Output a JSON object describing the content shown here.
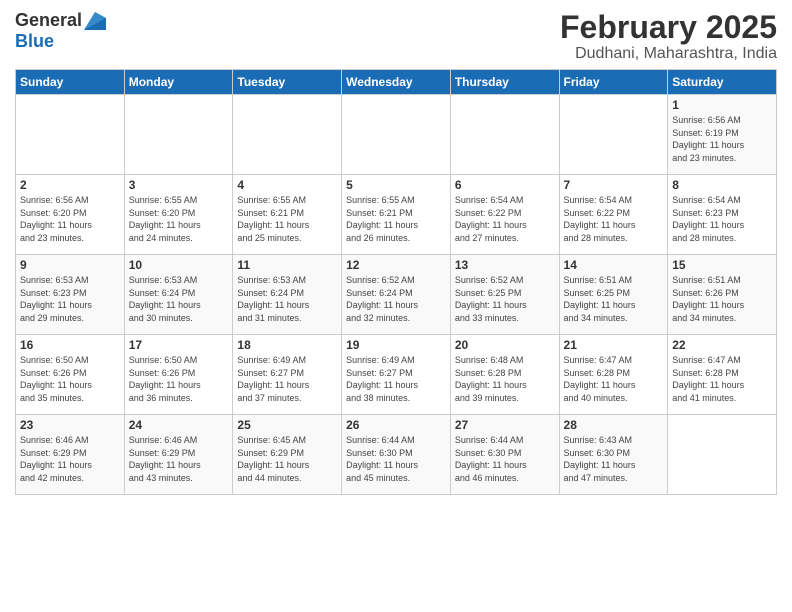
{
  "logo": {
    "general": "General",
    "blue": "Blue"
  },
  "title": "February 2025",
  "subtitle": "Dudhani, Maharashtra, India",
  "header": {
    "days": [
      "Sunday",
      "Monday",
      "Tuesday",
      "Wednesday",
      "Thursday",
      "Friday",
      "Saturday"
    ]
  },
  "weeks": [
    {
      "cells": [
        {
          "day": "",
          "info": ""
        },
        {
          "day": "",
          "info": ""
        },
        {
          "day": "",
          "info": ""
        },
        {
          "day": "",
          "info": ""
        },
        {
          "day": "",
          "info": ""
        },
        {
          "day": "",
          "info": ""
        },
        {
          "day": "1",
          "info": "Sunrise: 6:56 AM\nSunset: 6:19 PM\nDaylight: 11 hours\nand 23 minutes."
        }
      ]
    },
    {
      "cells": [
        {
          "day": "2",
          "info": "Sunrise: 6:56 AM\nSunset: 6:20 PM\nDaylight: 11 hours\nand 23 minutes."
        },
        {
          "day": "3",
          "info": "Sunrise: 6:55 AM\nSunset: 6:20 PM\nDaylight: 11 hours\nand 24 minutes."
        },
        {
          "day": "4",
          "info": "Sunrise: 6:55 AM\nSunset: 6:21 PM\nDaylight: 11 hours\nand 25 minutes."
        },
        {
          "day": "5",
          "info": "Sunrise: 6:55 AM\nSunset: 6:21 PM\nDaylight: 11 hours\nand 26 minutes."
        },
        {
          "day": "6",
          "info": "Sunrise: 6:54 AM\nSunset: 6:22 PM\nDaylight: 11 hours\nand 27 minutes."
        },
        {
          "day": "7",
          "info": "Sunrise: 6:54 AM\nSunset: 6:22 PM\nDaylight: 11 hours\nand 28 minutes."
        },
        {
          "day": "8",
          "info": "Sunrise: 6:54 AM\nSunset: 6:23 PM\nDaylight: 11 hours\nand 28 minutes."
        }
      ]
    },
    {
      "cells": [
        {
          "day": "9",
          "info": "Sunrise: 6:53 AM\nSunset: 6:23 PM\nDaylight: 11 hours\nand 29 minutes."
        },
        {
          "day": "10",
          "info": "Sunrise: 6:53 AM\nSunset: 6:24 PM\nDaylight: 11 hours\nand 30 minutes."
        },
        {
          "day": "11",
          "info": "Sunrise: 6:53 AM\nSunset: 6:24 PM\nDaylight: 11 hours\nand 31 minutes."
        },
        {
          "day": "12",
          "info": "Sunrise: 6:52 AM\nSunset: 6:24 PM\nDaylight: 11 hours\nand 32 minutes."
        },
        {
          "day": "13",
          "info": "Sunrise: 6:52 AM\nSunset: 6:25 PM\nDaylight: 11 hours\nand 33 minutes."
        },
        {
          "day": "14",
          "info": "Sunrise: 6:51 AM\nSunset: 6:25 PM\nDaylight: 11 hours\nand 34 minutes."
        },
        {
          "day": "15",
          "info": "Sunrise: 6:51 AM\nSunset: 6:26 PM\nDaylight: 11 hours\nand 34 minutes."
        }
      ]
    },
    {
      "cells": [
        {
          "day": "16",
          "info": "Sunrise: 6:50 AM\nSunset: 6:26 PM\nDaylight: 11 hours\nand 35 minutes."
        },
        {
          "day": "17",
          "info": "Sunrise: 6:50 AM\nSunset: 6:26 PM\nDaylight: 11 hours\nand 36 minutes."
        },
        {
          "day": "18",
          "info": "Sunrise: 6:49 AM\nSunset: 6:27 PM\nDaylight: 11 hours\nand 37 minutes."
        },
        {
          "day": "19",
          "info": "Sunrise: 6:49 AM\nSunset: 6:27 PM\nDaylight: 11 hours\nand 38 minutes."
        },
        {
          "day": "20",
          "info": "Sunrise: 6:48 AM\nSunset: 6:28 PM\nDaylight: 11 hours\nand 39 minutes."
        },
        {
          "day": "21",
          "info": "Sunrise: 6:47 AM\nSunset: 6:28 PM\nDaylight: 11 hours\nand 40 minutes."
        },
        {
          "day": "22",
          "info": "Sunrise: 6:47 AM\nSunset: 6:28 PM\nDaylight: 11 hours\nand 41 minutes."
        }
      ]
    },
    {
      "cells": [
        {
          "day": "23",
          "info": "Sunrise: 6:46 AM\nSunset: 6:29 PM\nDaylight: 11 hours\nand 42 minutes."
        },
        {
          "day": "24",
          "info": "Sunrise: 6:46 AM\nSunset: 6:29 PM\nDaylight: 11 hours\nand 43 minutes."
        },
        {
          "day": "25",
          "info": "Sunrise: 6:45 AM\nSunset: 6:29 PM\nDaylight: 11 hours\nand 44 minutes."
        },
        {
          "day": "26",
          "info": "Sunrise: 6:44 AM\nSunset: 6:30 PM\nDaylight: 11 hours\nand 45 minutes."
        },
        {
          "day": "27",
          "info": "Sunrise: 6:44 AM\nSunset: 6:30 PM\nDaylight: 11 hours\nand 46 minutes."
        },
        {
          "day": "28",
          "info": "Sunrise: 6:43 AM\nSunset: 6:30 PM\nDaylight: 11 hours\nand 47 minutes."
        },
        {
          "day": "",
          "info": ""
        }
      ]
    }
  ]
}
